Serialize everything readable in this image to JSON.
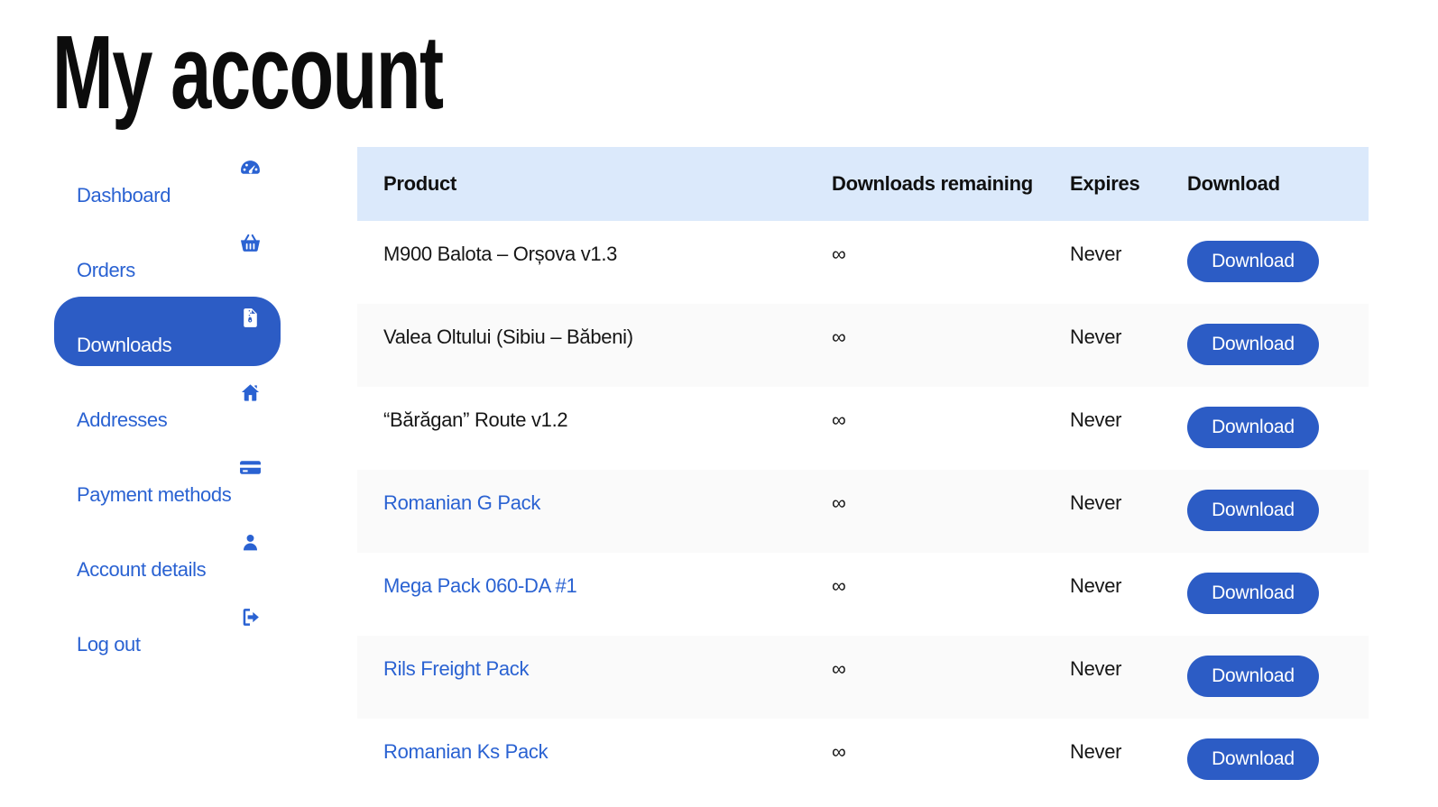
{
  "page": {
    "title": "My account"
  },
  "colors": {
    "accent": "#2c5cc5",
    "link": "#2a62d2",
    "table_header_bg": "#dbe9fb",
    "row_alt_bg": "#fafafa"
  },
  "sidebar": {
    "items": [
      {
        "label": "Dashboard",
        "icon": "tachometer",
        "active": false
      },
      {
        "label": "Orders",
        "icon": "basket",
        "active": false
      },
      {
        "label": "Downloads",
        "icon": "zip-file",
        "active": true
      },
      {
        "label": "Addresses",
        "icon": "home",
        "active": false
      },
      {
        "label": "Payment methods",
        "icon": "credit-card",
        "active": false
      },
      {
        "label": "Account details",
        "icon": "user",
        "active": false
      },
      {
        "label": "Log out",
        "icon": "sign-out",
        "active": false
      }
    ]
  },
  "downloads_table": {
    "columns": [
      "Product",
      "Downloads remaining",
      "Expires",
      "Download"
    ],
    "rows": [
      {
        "product": "M900 Balota – Orșova v1.3",
        "is_link": false,
        "remaining": "∞",
        "expires": "Never",
        "action": "Download"
      },
      {
        "product": "Valea Oltului (Sibiu – Băbeni)",
        "is_link": false,
        "remaining": "∞",
        "expires": "Never",
        "action": "Download"
      },
      {
        "product": "“Bărăgan” Route v1.2",
        "is_link": false,
        "remaining": "∞",
        "expires": "Never",
        "action": "Download"
      },
      {
        "product": "Romanian G Pack",
        "is_link": true,
        "remaining": "∞",
        "expires": "Never",
        "action": "Download"
      },
      {
        "product": "Mega Pack 060-DA #1",
        "is_link": true,
        "remaining": "∞",
        "expires": "Never",
        "action": "Download"
      },
      {
        "product": "Rils Freight Pack",
        "is_link": true,
        "remaining": "∞",
        "expires": "Never",
        "action": "Download"
      },
      {
        "product": "Romanian Ks Pack",
        "is_link": true,
        "remaining": "∞",
        "expires": "Never",
        "action": "Download"
      }
    ]
  }
}
